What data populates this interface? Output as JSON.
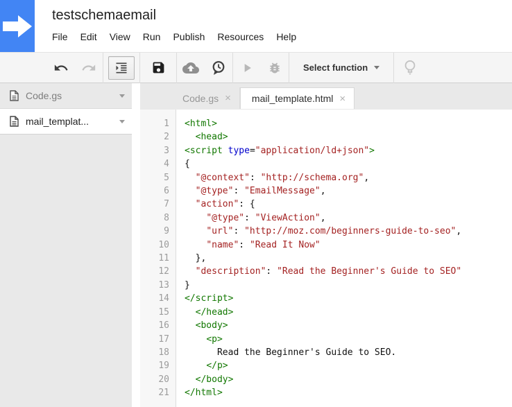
{
  "header": {
    "title": "testschemaemail",
    "menu": [
      "File",
      "Edit",
      "View",
      "Run",
      "Publish",
      "Resources",
      "Help"
    ]
  },
  "toolbar": {
    "select_function": "Select function",
    "icons": [
      "undo",
      "redo",
      "indent",
      "save",
      "cloud-upload",
      "history",
      "run",
      "debug",
      "ideas"
    ]
  },
  "sidebar": {
    "files": [
      {
        "name": "Code.gs",
        "selected": false
      },
      {
        "name": "mail_templat...",
        "selected": true
      }
    ]
  },
  "editor": {
    "close_glyph": "×",
    "tabs": [
      {
        "label": "Code.gs",
        "active": false
      },
      {
        "label": "mail_template.html",
        "active": true
      }
    ],
    "lines": [
      {
        "n": 1,
        "seg": [
          [
            "tag",
            "<html>"
          ]
        ]
      },
      {
        "n": 2,
        "seg": [
          [
            "plain",
            "  "
          ],
          [
            "tag",
            "<head>"
          ]
        ]
      },
      {
        "n": 3,
        "seg": [
          [
            "tag",
            "<script"
          ],
          [
            "plain",
            " "
          ],
          [
            "attr",
            "type"
          ],
          [
            "plain",
            "="
          ],
          [
            "str",
            "\"application/ld+json\""
          ],
          [
            "tag",
            ">"
          ]
        ]
      },
      {
        "n": 4,
        "seg": [
          [
            "plain",
            "{"
          ]
        ]
      },
      {
        "n": 5,
        "seg": [
          [
            "plain",
            "  "
          ],
          [
            "str",
            "\"@context\""
          ],
          [
            "plain",
            ": "
          ],
          [
            "str",
            "\"http://schema.org\""
          ],
          [
            "plain",
            ","
          ]
        ]
      },
      {
        "n": 6,
        "seg": [
          [
            "plain",
            "  "
          ],
          [
            "str",
            "\"@type\""
          ],
          [
            "plain",
            ": "
          ],
          [
            "str",
            "\"EmailMessage\""
          ],
          [
            "plain",
            ","
          ]
        ]
      },
      {
        "n": 7,
        "seg": [
          [
            "plain",
            "  "
          ],
          [
            "str",
            "\"action\""
          ],
          [
            "plain",
            ": {"
          ]
        ]
      },
      {
        "n": 8,
        "seg": [
          [
            "plain",
            "    "
          ],
          [
            "str",
            "\"@type\""
          ],
          [
            "plain",
            ": "
          ],
          [
            "str",
            "\"ViewAction\""
          ],
          [
            "plain",
            ","
          ]
        ]
      },
      {
        "n": 9,
        "seg": [
          [
            "plain",
            "    "
          ],
          [
            "str",
            "\"url\""
          ],
          [
            "plain",
            ": "
          ],
          [
            "str",
            "\"http://moz.com/beginners-guide-to-seo\""
          ],
          [
            "plain",
            ","
          ]
        ]
      },
      {
        "n": 10,
        "seg": [
          [
            "plain",
            "    "
          ],
          [
            "str",
            "\"name\""
          ],
          [
            "plain",
            ": "
          ],
          [
            "str",
            "\"Read It Now\""
          ]
        ]
      },
      {
        "n": 11,
        "seg": [
          [
            "plain",
            "  },"
          ]
        ]
      },
      {
        "n": 12,
        "seg": [
          [
            "plain",
            "  "
          ],
          [
            "str",
            "\"description\""
          ],
          [
            "plain",
            ": "
          ],
          [
            "str",
            "\"Read the Beginner's Guide to SEO\""
          ]
        ]
      },
      {
        "n": 13,
        "seg": [
          [
            "plain",
            "}"
          ]
        ]
      },
      {
        "n": 14,
        "seg": [
          [
            "tag",
            "</script>"
          ]
        ]
      },
      {
        "n": 15,
        "seg": [
          [
            "plain",
            "  "
          ],
          [
            "tag",
            "</head>"
          ]
        ]
      },
      {
        "n": 16,
        "seg": [
          [
            "plain",
            "  "
          ],
          [
            "tag",
            "<body>"
          ]
        ]
      },
      {
        "n": 17,
        "seg": [
          [
            "plain",
            "    "
          ],
          [
            "tag",
            "<p>"
          ]
        ]
      },
      {
        "n": 18,
        "seg": [
          [
            "plain",
            "      Read the Beginner's Guide to SEO."
          ]
        ]
      },
      {
        "n": 19,
        "seg": [
          [
            "plain",
            "    "
          ],
          [
            "tag",
            "</p>"
          ]
        ]
      },
      {
        "n": 20,
        "seg": [
          [
            "plain",
            "  "
          ],
          [
            "tag",
            "</body>"
          ]
        ]
      },
      {
        "n": 21,
        "seg": [
          [
            "tag",
            "</html>"
          ]
        ]
      }
    ]
  },
  "colors": {
    "logo_blue": "#4285f4",
    "tag_green": "#117700",
    "attr_blue": "#0000cc",
    "string_red": "#a42222"
  }
}
